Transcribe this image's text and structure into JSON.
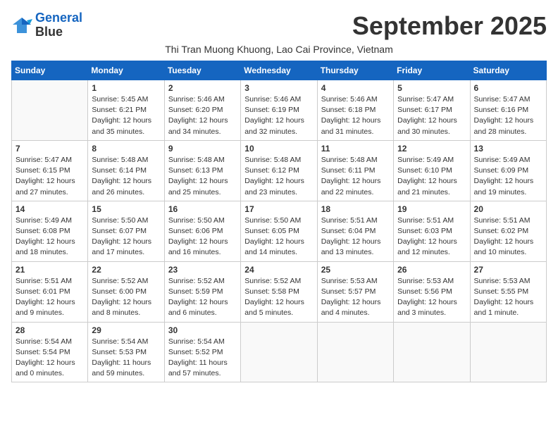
{
  "header": {
    "logo_line1": "General",
    "logo_line2": "Blue",
    "month_title": "September 2025",
    "subtitle": "Thi Tran Muong Khuong, Lao Cai Province, Vietnam"
  },
  "weekdays": [
    "Sunday",
    "Monday",
    "Tuesday",
    "Wednesday",
    "Thursday",
    "Friday",
    "Saturday"
  ],
  "weeks": [
    [
      {
        "day": "",
        "info": ""
      },
      {
        "day": "1",
        "info": "Sunrise: 5:45 AM\nSunset: 6:21 PM\nDaylight: 12 hours\nand 35 minutes."
      },
      {
        "day": "2",
        "info": "Sunrise: 5:46 AM\nSunset: 6:20 PM\nDaylight: 12 hours\nand 34 minutes."
      },
      {
        "day": "3",
        "info": "Sunrise: 5:46 AM\nSunset: 6:19 PM\nDaylight: 12 hours\nand 32 minutes."
      },
      {
        "day": "4",
        "info": "Sunrise: 5:46 AM\nSunset: 6:18 PM\nDaylight: 12 hours\nand 31 minutes."
      },
      {
        "day": "5",
        "info": "Sunrise: 5:47 AM\nSunset: 6:17 PM\nDaylight: 12 hours\nand 30 minutes."
      },
      {
        "day": "6",
        "info": "Sunrise: 5:47 AM\nSunset: 6:16 PM\nDaylight: 12 hours\nand 28 minutes."
      }
    ],
    [
      {
        "day": "7",
        "info": "Sunrise: 5:47 AM\nSunset: 6:15 PM\nDaylight: 12 hours\nand 27 minutes."
      },
      {
        "day": "8",
        "info": "Sunrise: 5:48 AM\nSunset: 6:14 PM\nDaylight: 12 hours\nand 26 minutes."
      },
      {
        "day": "9",
        "info": "Sunrise: 5:48 AM\nSunset: 6:13 PM\nDaylight: 12 hours\nand 25 minutes."
      },
      {
        "day": "10",
        "info": "Sunrise: 5:48 AM\nSunset: 6:12 PM\nDaylight: 12 hours\nand 23 minutes."
      },
      {
        "day": "11",
        "info": "Sunrise: 5:48 AM\nSunset: 6:11 PM\nDaylight: 12 hours\nand 22 minutes."
      },
      {
        "day": "12",
        "info": "Sunrise: 5:49 AM\nSunset: 6:10 PM\nDaylight: 12 hours\nand 21 minutes."
      },
      {
        "day": "13",
        "info": "Sunrise: 5:49 AM\nSunset: 6:09 PM\nDaylight: 12 hours\nand 19 minutes."
      }
    ],
    [
      {
        "day": "14",
        "info": "Sunrise: 5:49 AM\nSunset: 6:08 PM\nDaylight: 12 hours\nand 18 minutes."
      },
      {
        "day": "15",
        "info": "Sunrise: 5:50 AM\nSunset: 6:07 PM\nDaylight: 12 hours\nand 17 minutes."
      },
      {
        "day": "16",
        "info": "Sunrise: 5:50 AM\nSunset: 6:06 PM\nDaylight: 12 hours\nand 16 minutes."
      },
      {
        "day": "17",
        "info": "Sunrise: 5:50 AM\nSunset: 6:05 PM\nDaylight: 12 hours\nand 14 minutes."
      },
      {
        "day": "18",
        "info": "Sunrise: 5:51 AM\nSunset: 6:04 PM\nDaylight: 12 hours\nand 13 minutes."
      },
      {
        "day": "19",
        "info": "Sunrise: 5:51 AM\nSunset: 6:03 PM\nDaylight: 12 hours\nand 12 minutes."
      },
      {
        "day": "20",
        "info": "Sunrise: 5:51 AM\nSunset: 6:02 PM\nDaylight: 12 hours\nand 10 minutes."
      }
    ],
    [
      {
        "day": "21",
        "info": "Sunrise: 5:51 AM\nSunset: 6:01 PM\nDaylight: 12 hours\nand 9 minutes."
      },
      {
        "day": "22",
        "info": "Sunrise: 5:52 AM\nSunset: 6:00 PM\nDaylight: 12 hours\nand 8 minutes."
      },
      {
        "day": "23",
        "info": "Sunrise: 5:52 AM\nSunset: 5:59 PM\nDaylight: 12 hours\nand 6 minutes."
      },
      {
        "day": "24",
        "info": "Sunrise: 5:52 AM\nSunset: 5:58 PM\nDaylight: 12 hours\nand 5 minutes."
      },
      {
        "day": "25",
        "info": "Sunrise: 5:53 AM\nSunset: 5:57 PM\nDaylight: 12 hours\nand 4 minutes."
      },
      {
        "day": "26",
        "info": "Sunrise: 5:53 AM\nSunset: 5:56 PM\nDaylight: 12 hours\nand 3 minutes."
      },
      {
        "day": "27",
        "info": "Sunrise: 5:53 AM\nSunset: 5:55 PM\nDaylight: 12 hours\nand 1 minute."
      }
    ],
    [
      {
        "day": "28",
        "info": "Sunrise: 5:54 AM\nSunset: 5:54 PM\nDaylight: 12 hours\nand 0 minutes."
      },
      {
        "day": "29",
        "info": "Sunrise: 5:54 AM\nSunset: 5:53 PM\nDaylight: 11 hours\nand 59 minutes."
      },
      {
        "day": "30",
        "info": "Sunrise: 5:54 AM\nSunset: 5:52 PM\nDaylight: 11 hours\nand 57 minutes."
      },
      {
        "day": "",
        "info": ""
      },
      {
        "day": "",
        "info": ""
      },
      {
        "day": "",
        "info": ""
      },
      {
        "day": "",
        "info": ""
      }
    ]
  ]
}
